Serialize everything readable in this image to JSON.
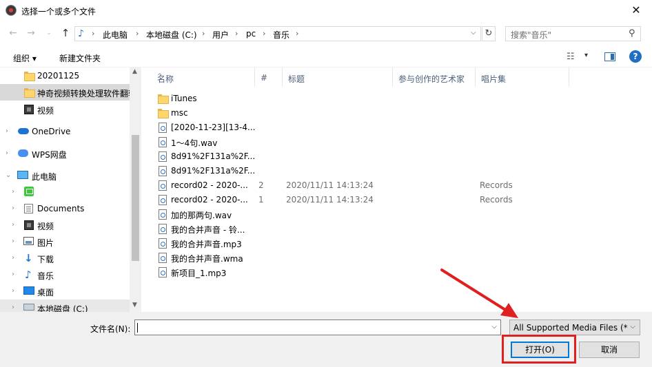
{
  "window": {
    "title": "选择一个或多个文件",
    "close_label": "✕"
  },
  "nav": {
    "breadcrumbs": [
      "此电脑",
      "本地磁盘 (C:)",
      "用户",
      "pc",
      "音乐"
    ],
    "search_placeholder": "搜索\"音乐\""
  },
  "toolbar": {
    "organize": "组织 ▾",
    "new_folder": "新建文件夹"
  },
  "sidebar": {
    "items": [
      {
        "label": "20201125",
        "icon": "folder-icon"
      },
      {
        "label": "神奇视频转换处理软件翻转",
        "icon": "folder-icon"
      },
      {
        "label": "视频",
        "icon": "video-icon"
      },
      {
        "label": "OneDrive",
        "icon": "cloud-icon"
      },
      {
        "label": "WPS网盘",
        "icon": "wps-icon"
      },
      {
        "label": "此电脑",
        "icon": "pc-icon"
      },
      {
        "label": "",
        "icon": "app-green-icon"
      },
      {
        "label": "Documents",
        "icon": "documents-icon"
      },
      {
        "label": "视频",
        "icon": "video-icon"
      },
      {
        "label": "图片",
        "icon": "pictures-icon"
      },
      {
        "label": "下载",
        "icon": "download-icon"
      },
      {
        "label": "音乐",
        "icon": "music-icon"
      },
      {
        "label": "桌面",
        "icon": "desktop-icon"
      },
      {
        "label": "本地磁盘 (C:)",
        "icon": "drive-icon"
      }
    ]
  },
  "columns": {
    "name": "名称",
    "num": "#",
    "title": "标题",
    "artist": "参与创作的艺术家",
    "album": "唱片集"
  },
  "files": [
    {
      "name": "iTunes",
      "type": "folder",
      "num": "",
      "title": "",
      "album": ""
    },
    {
      "name": "msc",
      "type": "folder",
      "num": "",
      "title": "",
      "album": ""
    },
    {
      "name": "[2020-11-23][13-4...",
      "type": "audio",
      "num": "",
      "title": "",
      "album": ""
    },
    {
      "name": "1～4句.wav",
      "type": "audio",
      "num": "",
      "title": "",
      "album": ""
    },
    {
      "name": "8d91%2F131a%2F...",
      "type": "audio",
      "num": "",
      "title": "",
      "album": ""
    },
    {
      "name": "8d91%2F131a%2F...",
      "type": "audio",
      "num": "",
      "title": "",
      "album": ""
    },
    {
      "name": "record02 - 2020-...",
      "type": "audio",
      "num": "2",
      "title": "2020/11/11 14:13:24",
      "album": "Records"
    },
    {
      "name": "record02 - 2020-...",
      "type": "audio",
      "num": "1",
      "title": "2020/11/11 14:13:24",
      "album": "Records"
    },
    {
      "name": "加的那两句.wav",
      "type": "audio",
      "num": "",
      "title": "",
      "album": ""
    },
    {
      "name": "我的合并声音 - 铃...",
      "type": "audio",
      "num": "",
      "title": "",
      "album": ""
    },
    {
      "name": "我的合并声音.mp3",
      "type": "audio",
      "num": "",
      "title": "",
      "album": ""
    },
    {
      "name": "我的合并声音.wma",
      "type": "audio",
      "num": "",
      "title": "",
      "album": ""
    },
    {
      "name": "新项目_1.mp3",
      "type": "audio",
      "num": "",
      "title": "",
      "album": ""
    }
  ],
  "bottom": {
    "filename_label": "文件名(N):",
    "filename_value": "",
    "filter": "All Supported Media Files (*",
    "open_button": "打开(O)",
    "cancel_button": "取消"
  },
  "colors": {
    "accent": "#0078d7",
    "annotation": "#e02020"
  }
}
